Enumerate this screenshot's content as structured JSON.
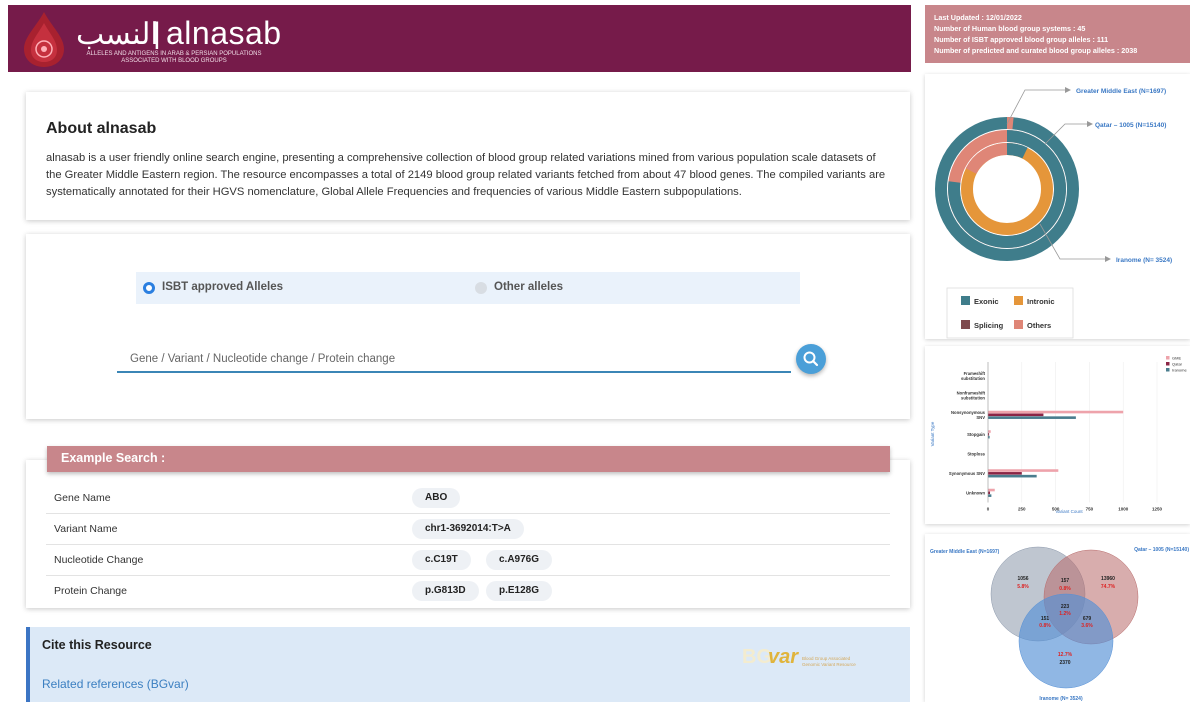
{
  "header": {
    "logo_arabic": "النسب",
    "logo_text": "alnasab",
    "logo_subtitle_line1": "ALLELES AND ANTIGENS IN ARAB & PERSIAN POPULATIONS",
    "logo_subtitle_line2": "ASSOCIATED WITH BLOOD GROUPS"
  },
  "info": {
    "last_updated": "Last Updated : 12/01/2022",
    "systems": "Number of Human blood group systems : 45",
    "isbt": "Number of ISBT approved blood group alleles : 111",
    "predicted": "Number of predicted and curated blood group alleles : 2038"
  },
  "about": {
    "title": "About alnasab",
    "text": "alnasab is a user friendly online search engine, presenting a comprehensive collection of blood group related variations mined from various population scale datasets of the Greater Middle Eastern region. The resource encompasses a total of 2149 blood group related variants fetched from about 47 blood genes. The compiled variants are systematically annotated for their HGVS nomenclature, Global Allele Frequencies and frequencies of various Middle Eastern subpopulations."
  },
  "search": {
    "option_isbt": "ISBT approved Alleles",
    "option_other": "Other alleles",
    "placeholder": "Gene / Variant / Nucleotide change / Protein change"
  },
  "example": {
    "title": "Example Search :",
    "rows": [
      {
        "label": "Gene Name",
        "chips": [
          "ABO"
        ]
      },
      {
        "label": "Variant Name",
        "chips": [
          "chr1-3692014:T>A"
        ]
      },
      {
        "label": "Nucleotide Change",
        "chips": [
          "c.C19T",
          "c.A976G"
        ]
      },
      {
        "label": "Protein Change",
        "chips": [
          "p.G813D",
          "p.E128G"
        ]
      }
    ]
  },
  "cite": {
    "title": "Cite this Resource",
    "link": "Related references (BGvar)",
    "logo_bg": "BG",
    "logo_var": "var",
    "logo_tag1": "Blood Group Associated",
    "logo_tag2": "Genomic Variant Resource"
  },
  "donut": {
    "labels": {
      "outer": "Greater Middle East (N=1697)",
      "middle": "Qatar – 1005 (N=15140)",
      "inner": "Iranome (N= 3524)"
    },
    "legend": [
      "Exonic",
      "Intronic",
      "Splicing",
      "Others"
    ],
    "colors": {
      "Exonic": "#3f7d8b",
      "Intronic": "#e5963a",
      "Splicing": "#7e4a4e",
      "Others": "#df8677"
    }
  },
  "bar_chart": {
    "categories": [
      "Frameshift substitution",
      "Nonframeshift substitution",
      "Nonsynonymous SNV",
      "Stopgain",
      "Stoploss",
      "Synonymous SNV",
      "Unknown"
    ],
    "category_lines": [
      [
        "Frameshift",
        "substitution"
      ],
      [
        "Nonframeshift",
        "substitution"
      ],
      [
        "Nonsynonymous",
        "SNV"
      ],
      [
        "Stopgain"
      ],
      [
        "Stoploss"
      ],
      [
        "Synonymous SNV"
      ],
      [
        "Unknown"
      ]
    ],
    "series": [
      {
        "name": "GME",
        "color": "#eea3ab",
        "values": [
          0,
          0,
          1000,
          20,
          0,
          520,
          50
        ]
      },
      {
        "name": "Qatar",
        "color": "#8b2545",
        "values": [
          0,
          0,
          410,
          8,
          0,
          250,
          15
        ]
      },
      {
        "name": "Iranome",
        "color": "#4a7d8e",
        "values": [
          0,
          0,
          650,
          12,
          0,
          360,
          25
        ]
      }
    ],
    "ticks": [
      "0",
      "250",
      "500",
      "750",
      "1000",
      "1250"
    ],
    "xlabel": "Variant Count",
    "ylabel": "Variant Type"
  },
  "venn": {
    "label_gme": "Greater Middle East (N=1697)",
    "label_qatar": "Qatar – 1005 (N=15140)",
    "label_iran": "Iranome (N= 3524)",
    "gme_only": "1056",
    "gme_only_pct": "5.8%",
    "gq": "157",
    "gq_pct": "0.8%",
    "qatar_only": "13960",
    "qatar_only_pct": "74.7%",
    "all": "223",
    "all_pct": "1.2%",
    "gi": "151",
    "gi_pct": "0.8%",
    "qi": "679",
    "qi_pct": "3.6%",
    "iran_only": "2370",
    "iran_only_pct": "12.7%"
  }
}
